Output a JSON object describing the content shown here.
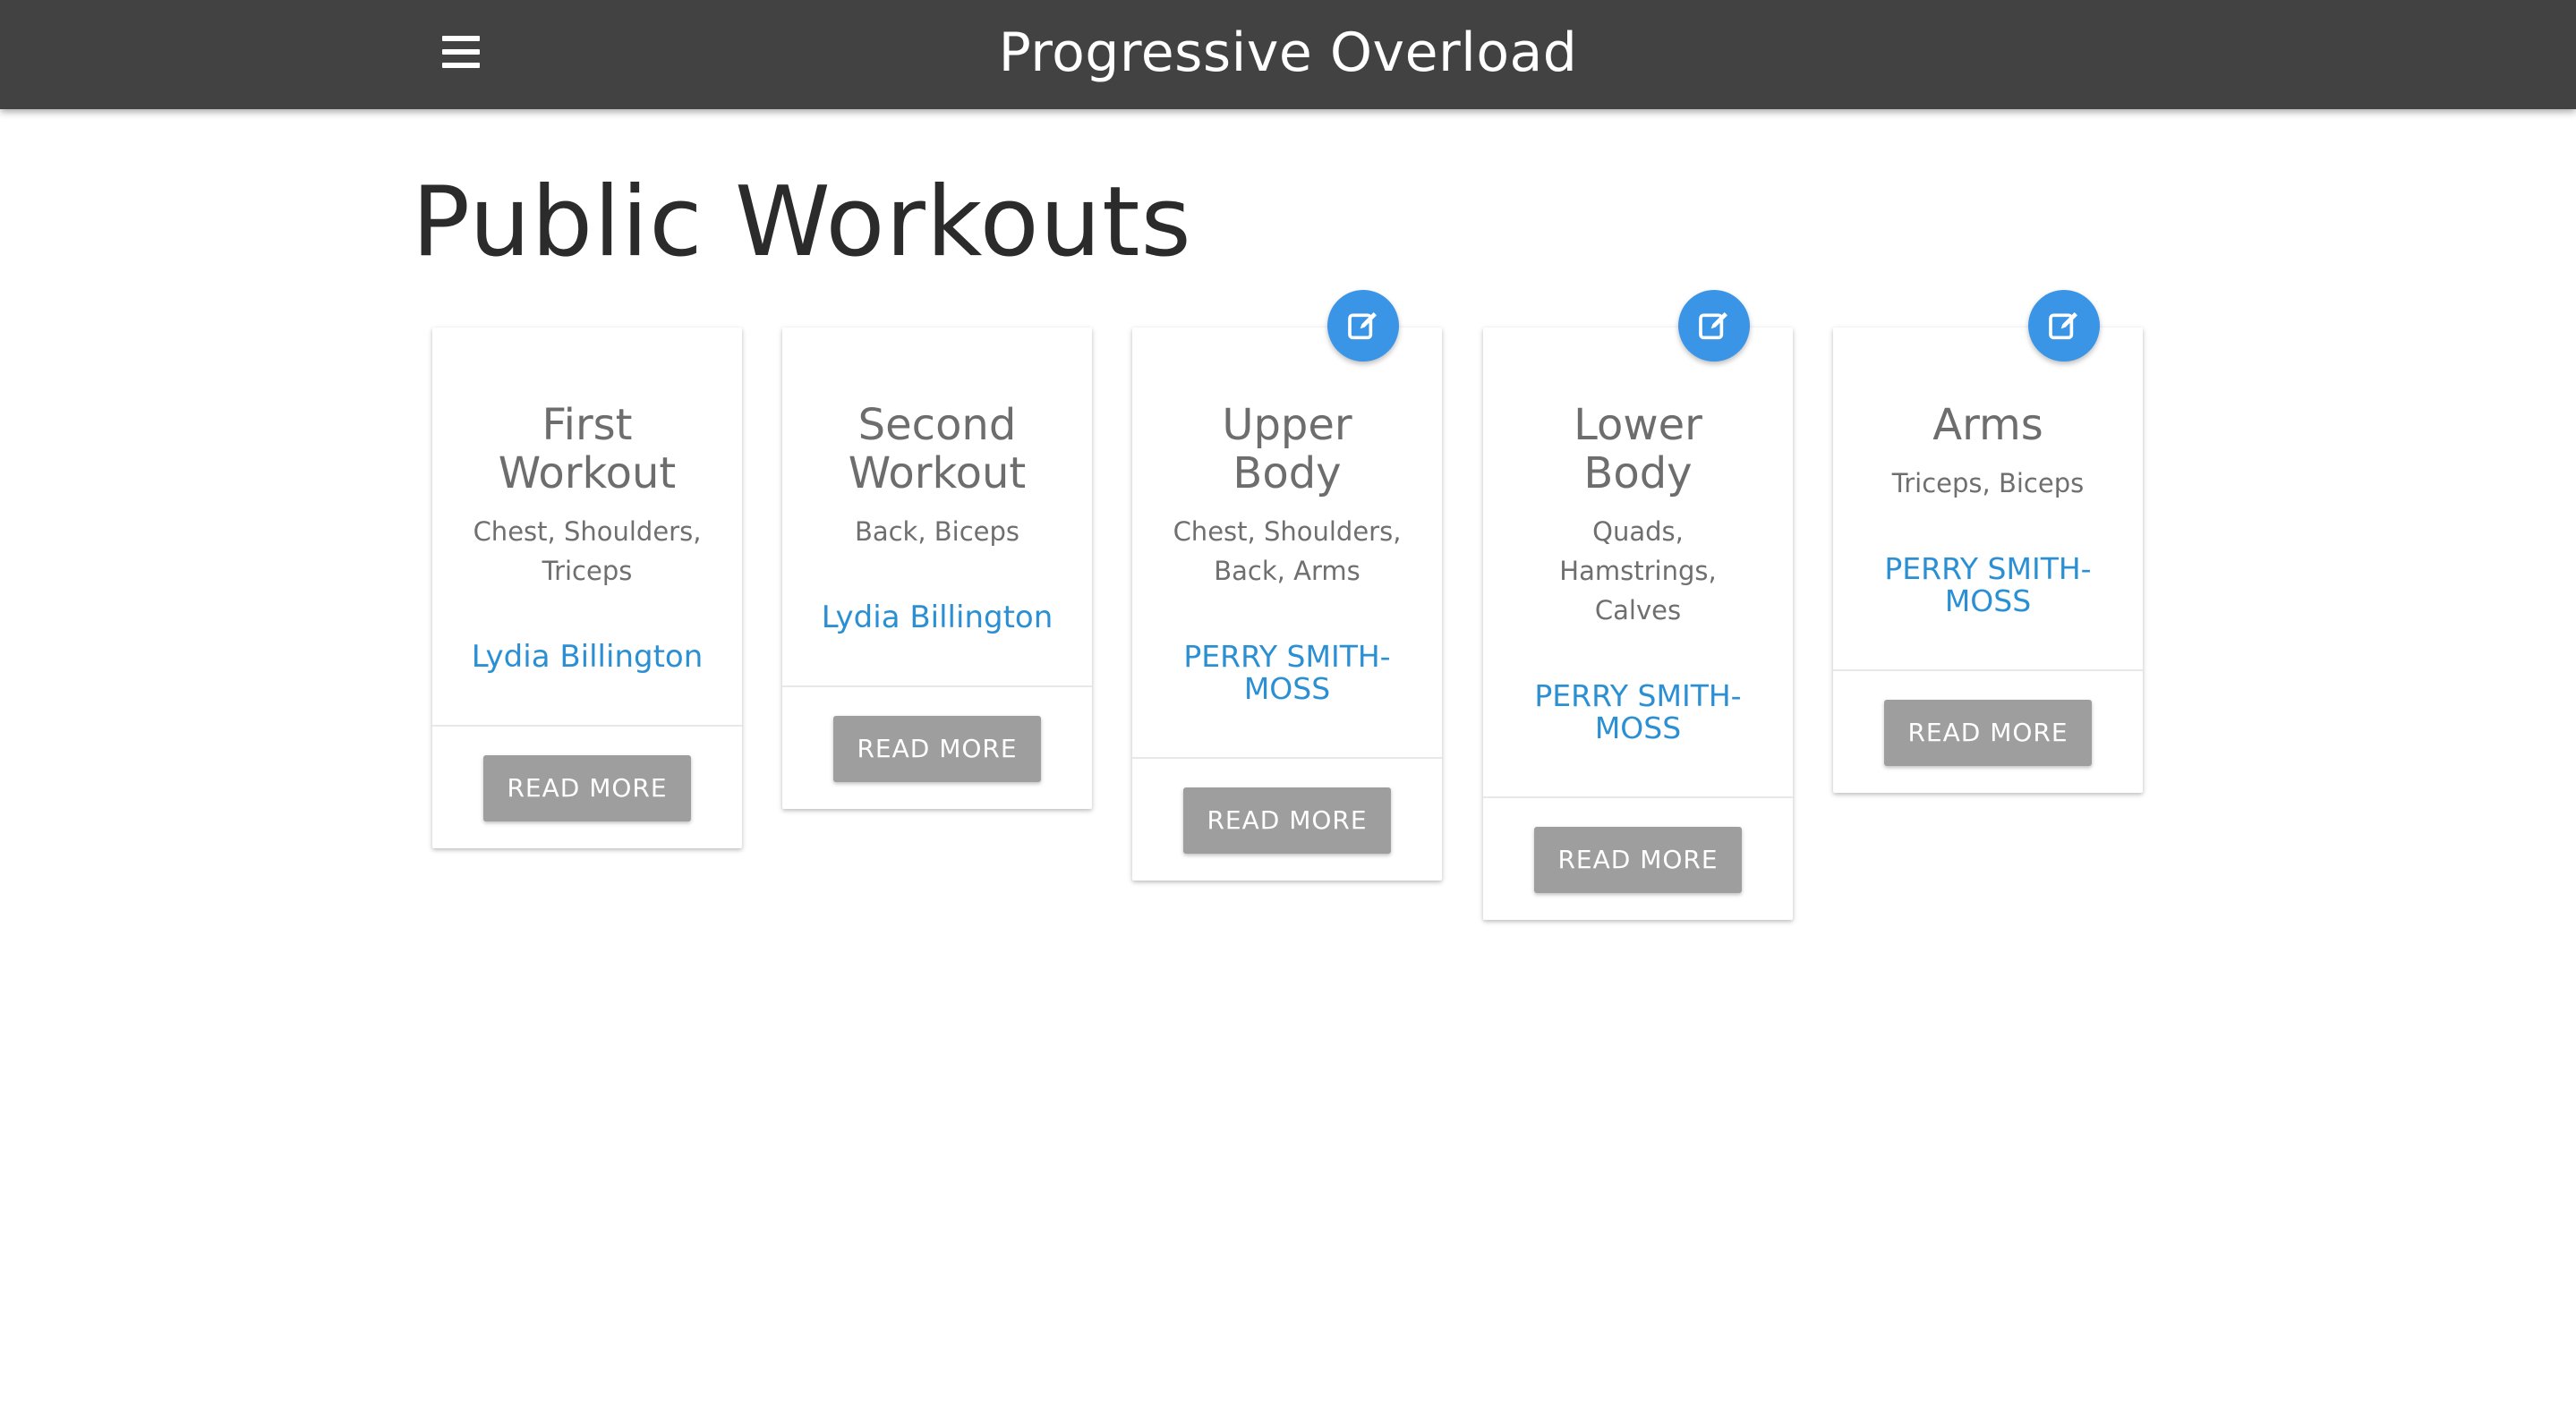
{
  "navbar": {
    "brand": "Progressive Overload",
    "menu_icon": "hamburger-menu-icon"
  },
  "page": {
    "title": "Public Workouts"
  },
  "cards": [
    {
      "title": "First Workout",
      "muscles": "Chest, Shoulders, Triceps",
      "author": "Lydia Billington",
      "button": "READ MORE",
      "editable": false
    },
    {
      "title": "Second Workout",
      "muscles": "Back, Biceps",
      "author": "Lydia Billington",
      "button": "READ MORE",
      "editable": false
    },
    {
      "title": "Upper Body",
      "muscles": "Chest, Shoulders, Back, Arms",
      "author": "PERRY SMITH-MOSS",
      "button": "READ MORE",
      "editable": true,
      "edit_icon": "edit-icon"
    },
    {
      "title": "Lower Body",
      "muscles": "Quads, Hamstrings, Calves",
      "author": "PERRY SMITH-MOSS",
      "button": "READ MORE",
      "editable": true,
      "edit_icon": "edit-icon"
    },
    {
      "title": "Arms",
      "muscles": "Triceps, Biceps",
      "author": "PERRY SMITH-MOSS",
      "button": "READ MORE",
      "editable": true,
      "edit_icon": "edit-icon"
    }
  ],
  "colors": {
    "navbar": "#424242",
    "accent": "#3b95e6",
    "author_link": "#2a8fd3",
    "button": "#9e9e9e"
  }
}
